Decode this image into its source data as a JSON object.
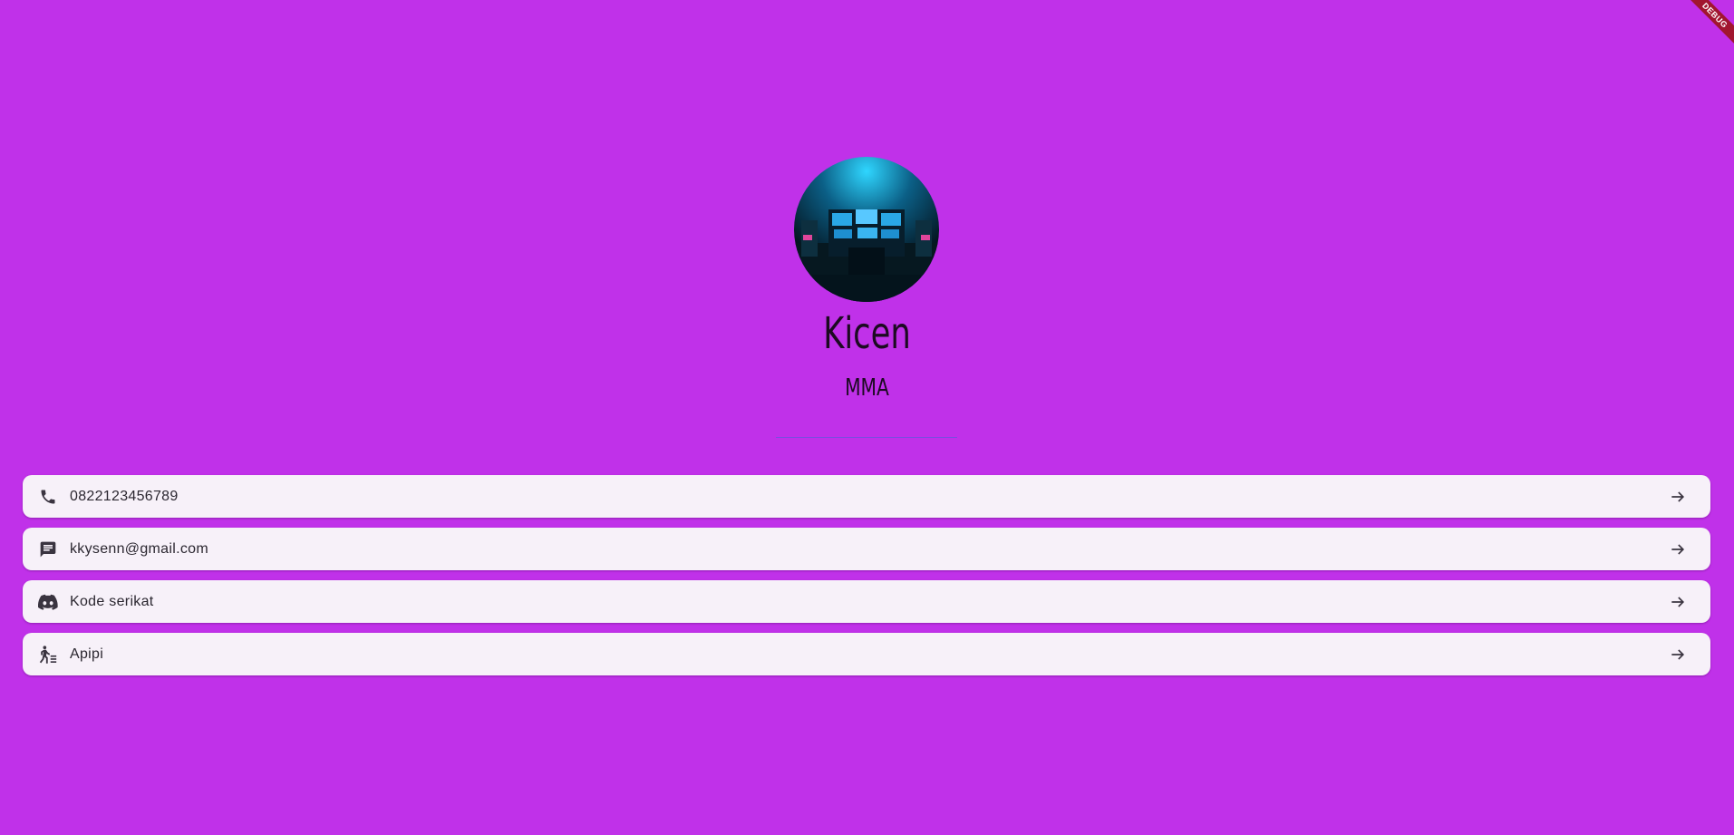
{
  "profile": {
    "name": "Kicen",
    "title": "MMA"
  },
  "contacts": [
    {
      "icon": "phone-icon",
      "label": "0822123456789"
    },
    {
      "icon": "message-icon",
      "label": "kkysenn@gmail.com"
    },
    {
      "icon": "discord-icon",
      "label": "Kode serikat"
    },
    {
      "icon": "person-walking-list-icon",
      "label": "Apipi"
    }
  ],
  "debug_banner": "DEBUG",
  "colors": {
    "background": "#c031e9",
    "card": "#f7f1f9",
    "text_dark": "#1c0a21",
    "divider": "#7a4de0",
    "debug_ribbon": "#a1162f"
  }
}
